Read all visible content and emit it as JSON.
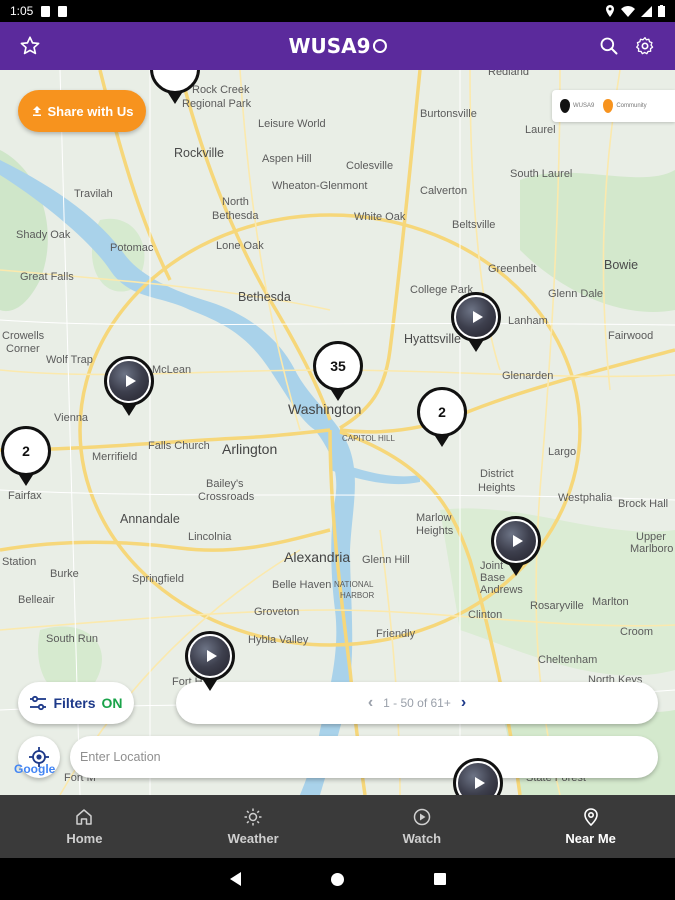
{
  "status_bar": {
    "time": "1:05"
  },
  "app_bar": {
    "logo_text": "WUSA9"
  },
  "map": {
    "share_label": "Share with Us",
    "legend": {
      "wusa_label": "WUSA9",
      "community_label": "Community",
      "wusa_color": "#111111",
      "community_color": "#f7931e"
    },
    "places": [
      {
        "name": "Rock Creek",
        "cls": ""
      },
      {
        "name": "Regional Park",
        "cls": ""
      },
      {
        "name": "Redland",
        "cls": ""
      },
      {
        "name": "Burtonsville",
        "cls": ""
      },
      {
        "name": "Laurel",
        "cls": ""
      },
      {
        "name": "Rockville",
        "cls": "med"
      },
      {
        "name": "Leisure World",
        "cls": ""
      },
      {
        "name": "Aspen Hill",
        "cls": ""
      },
      {
        "name": "Colesville",
        "cls": ""
      },
      {
        "name": "South Laurel",
        "cls": ""
      },
      {
        "name": "Wheaton-Glenmont",
        "cls": ""
      },
      {
        "name": "Calverton",
        "cls": ""
      },
      {
        "name": "Travilah",
        "cls": ""
      },
      {
        "name": "North",
        "cls": ""
      },
      {
        "name": "Bethesda",
        "cls": ""
      },
      {
        "name": "White Oak",
        "cls": ""
      },
      {
        "name": "Beltsville",
        "cls": ""
      },
      {
        "name": "Shady Oak",
        "cls": ""
      },
      {
        "name": "Potomac",
        "cls": ""
      },
      {
        "name": "Lone Oak",
        "cls": ""
      },
      {
        "name": "Great Falls",
        "cls": ""
      },
      {
        "name": "Greenbelt",
        "cls": ""
      },
      {
        "name": "Bowie",
        "cls": "med"
      },
      {
        "name": "Bethesda",
        "cls": "med"
      },
      {
        "name": "College Park",
        "cls": ""
      },
      {
        "name": "Glenn Dale",
        "cls": ""
      },
      {
        "name": "Lanham",
        "cls": ""
      },
      {
        "name": "Crowells",
        "cls": ""
      },
      {
        "name": "Corner",
        "cls": ""
      },
      {
        "name": "Hyattsville",
        "cls": "med"
      },
      {
        "name": "Fairwood",
        "cls": ""
      },
      {
        "name": "Wolf Trap",
        "cls": ""
      },
      {
        "name": "McLean",
        "cls": ""
      },
      {
        "name": "Glenarden",
        "cls": ""
      },
      {
        "name": "Vienna",
        "cls": ""
      },
      {
        "name": "Washington",
        "cls": "big"
      },
      {
        "name": "Falls Church",
        "cls": ""
      },
      {
        "name": "Arlington",
        "cls": "big"
      },
      {
        "name": "CAPITOL HILL",
        "cls": ""
      },
      {
        "name": "Merrifield",
        "cls": ""
      },
      {
        "name": "Largo",
        "cls": ""
      },
      {
        "name": "District",
        "cls": ""
      },
      {
        "name": "Heights",
        "cls": ""
      },
      {
        "name": "Fairfax",
        "cls": ""
      },
      {
        "name": "Bailey's",
        "cls": ""
      },
      {
        "name": "Crossroads",
        "cls": ""
      },
      {
        "name": "Westphalia",
        "cls": ""
      },
      {
        "name": "Brock Hall",
        "cls": ""
      },
      {
        "name": "Annandale",
        "cls": "med"
      },
      {
        "name": "Marlow",
        "cls": ""
      },
      {
        "name": "Heights",
        "cls": ""
      },
      {
        "name": "Lincolnia",
        "cls": ""
      },
      {
        "name": "Upper",
        "cls": ""
      },
      {
        "name": "Marlboro",
        "cls": ""
      },
      {
        "name": "Station",
        "cls": ""
      },
      {
        "name": "Alexandria",
        "cls": "big"
      },
      {
        "name": "Glenn Hill",
        "cls": ""
      },
      {
        "name": "Burke",
        "cls": ""
      },
      {
        "name": "Springfield",
        "cls": ""
      },
      {
        "name": "Belle Haven",
        "cls": ""
      },
      {
        "name": "NATIONAL",
        "cls": ""
      },
      {
        "name": "HARBOR",
        "cls": ""
      },
      {
        "name": "Rosaryville",
        "cls": ""
      },
      {
        "name": "Belleair",
        "cls": ""
      },
      {
        "name": "Groveton",
        "cls": ""
      },
      {
        "name": "Marlton",
        "cls": ""
      },
      {
        "name": "Clinton",
        "cls": ""
      },
      {
        "name": "South Run",
        "cls": ""
      },
      {
        "name": "Hybla Valley",
        "cls": ""
      },
      {
        "name": "Friendly",
        "cls": ""
      },
      {
        "name": "Croom",
        "cls": ""
      },
      {
        "name": "Cheltenham",
        "cls": ""
      },
      {
        "name": "Fort H",
        "cls": ""
      },
      {
        "name": "North Keys",
        "cls": ""
      },
      {
        "name": "State Forest",
        "cls": ""
      },
      {
        "name": "Fort M",
        "cls": ""
      },
      {
        "name": "Joint Base Andrews",
        "cls": ""
      }
    ],
    "clusters": [
      {
        "count": "2"
      },
      {
        "count": "35"
      },
      {
        "count": "2"
      }
    ],
    "filters": {
      "label": "Filters",
      "state": "ON"
    },
    "pager": {
      "prev": "‹",
      "text": "1 - 50 of 61+",
      "next": "›"
    },
    "location": {
      "placeholder": "Enter Location",
      "value": ""
    },
    "google_label": "Google"
  },
  "bottom_nav": {
    "items": [
      {
        "label": "Home",
        "icon": "home-icon"
      },
      {
        "label": "Weather",
        "icon": "sun-icon"
      },
      {
        "label": "Watch",
        "icon": "play-circle-icon"
      },
      {
        "label": "Near Me",
        "icon": "location-pin-icon"
      }
    ],
    "active": "Near Me"
  }
}
